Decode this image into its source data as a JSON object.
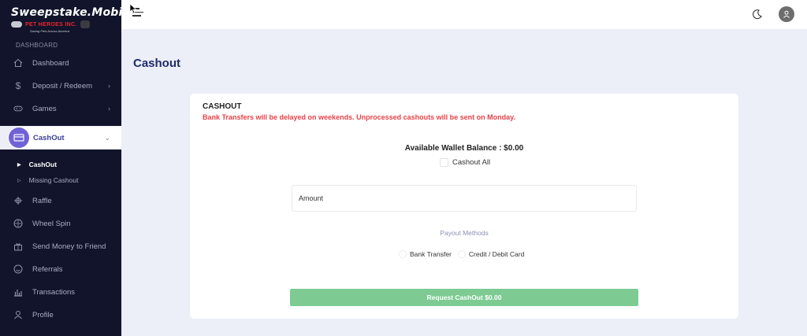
{
  "brand": {
    "name": "Sweepstake.Mobi",
    "sub": "PET HEROES INC.",
    "tagline": "Saving Pets Across America"
  },
  "sidebar": {
    "section_label": "DASHBOARD",
    "items": [
      {
        "label": "Dashboard",
        "icon": "home-icon"
      },
      {
        "label": "Deposit / Redeem",
        "icon": "dollar-icon",
        "has_chevron": true
      },
      {
        "label": "Games",
        "icon": "gamepad-icon",
        "has_chevron": true
      },
      {
        "label": "CashOut",
        "icon": "credit-card-icon",
        "has_chevron": true,
        "active": true
      },
      {
        "label": "Raffle",
        "icon": "puzzle-icon"
      },
      {
        "label": "Wheel Spin",
        "icon": "wheel-icon"
      },
      {
        "label": "Send Money to Friend",
        "icon": "gift-icon"
      },
      {
        "label": "Referrals",
        "icon": "smile-icon"
      },
      {
        "label": "Transactions",
        "icon": "bar-chart-icon"
      },
      {
        "label": "Profile",
        "icon": "user-icon"
      }
    ],
    "cashout_sub": [
      {
        "label": "CashOut",
        "active": true
      },
      {
        "label": "Missing Cashout",
        "active": false
      }
    ]
  },
  "page": {
    "title": "Cashout"
  },
  "card": {
    "heading": "CASHOUT",
    "warning": "Bank Transfers will be delayed on weekends. Unprocessed cashouts will be sent on Monday.",
    "balance": "Available Wallet Balance : $0.00",
    "cashout_all": "Cashout All",
    "amount_placeholder": "Amount",
    "payout_label": "Payout Methods",
    "payout_options": [
      "Bank Transfer",
      "Credit / Debit Card"
    ],
    "request_button": "Request CashOut $0.00"
  },
  "colors": {
    "sidebar_bg": "#11142a",
    "accent": "#6f62d8",
    "warning": "#e8424a",
    "button": "#7dcb93",
    "title": "#1f2a6b"
  }
}
